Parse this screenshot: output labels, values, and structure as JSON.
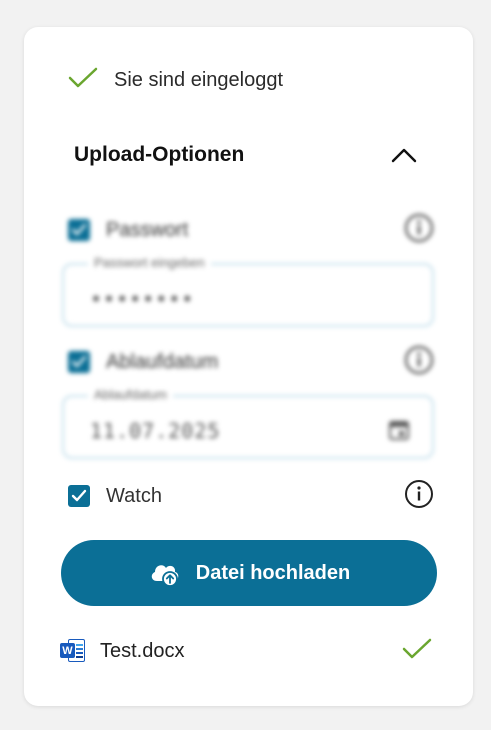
{
  "status": {
    "logged_in_text": "Sie sind eingeloggt",
    "icon": "check-icon",
    "color": "#6aa62f"
  },
  "upload_options": {
    "title": "Upload-Optionen",
    "collapse_icon": "chevron-up-icon",
    "password": {
      "label": "Passwort",
      "checked": true,
      "field_label": "Passwort eingeben",
      "field_value": "••••••••"
    },
    "expiry": {
      "label": "Ablaufdatum",
      "checked": true,
      "field_label": "Ablaufdatum",
      "field_value": "11.07.2025"
    },
    "watch": {
      "label": "Watch",
      "checked": true
    }
  },
  "upload_button": {
    "label": "Datei hochladen",
    "icon": "cloud-upload-icon",
    "color": "#0b6f96"
  },
  "files": [
    {
      "name": "Test.docx",
      "icon": "word-icon",
      "status_icon": "check-icon"
    }
  ]
}
